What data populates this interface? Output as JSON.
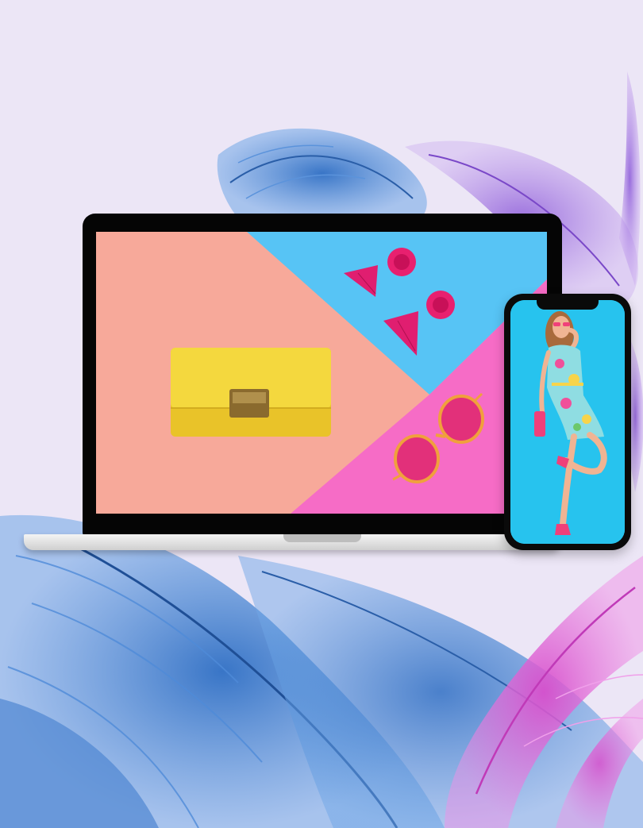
{
  "scene": {
    "description_colors": {
      "background": "#ece6f6",
      "feather_blue": "#3b7fd1",
      "feather_pink": "#e06ad6",
      "feather_purple": "#a36be0"
    }
  },
  "laptop": {
    "screen_colors": {
      "peach": "#f7a99a",
      "sky": "#57c4f5",
      "pink": "#f66cc6",
      "clutch": "#f2d238",
      "clasp": "#8a6a2e",
      "earring": "#e8206f",
      "glasses": "#f0a03c"
    }
  },
  "phone": {
    "screen_colors": {
      "background": "#27c3ee",
      "dress": "#8fdde2",
      "skin": "#f0b493",
      "hair": "#a86a3c",
      "shoes": "#f0407a"
    }
  }
}
